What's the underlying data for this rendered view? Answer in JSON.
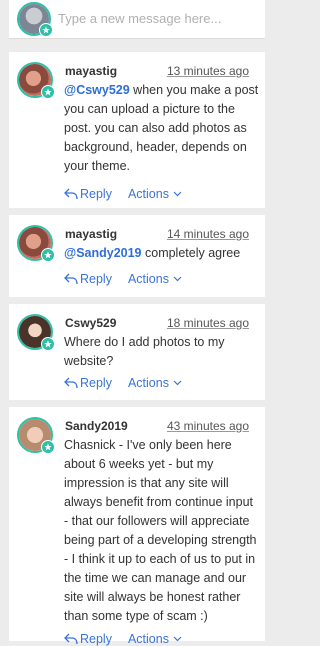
{
  "composer": {
    "placeholder": "Type a new message here..."
  },
  "comments": [
    {
      "author": "mayastig",
      "time": "13 minutes ago",
      "mention": "@Cswy529",
      "text": " when you make a post you can upload a picture to the post. you can also add photos as background, header, depends on your theme.",
      "reply_label": "Reply",
      "actions_label": "Actions"
    },
    {
      "author": "mayastig",
      "time": "14 minutes ago",
      "mention": "@Sandy2019",
      "text": " completely agree",
      "reply_label": "Reply",
      "actions_label": "Actions"
    },
    {
      "author": "Cswy529",
      "time": "18 minutes ago",
      "mention": "",
      "text": "Where do I add photos to my website?",
      "reply_label": "Reply",
      "actions_label": "Actions"
    },
    {
      "author": "Sandy2019",
      "time": "43 minutes ago",
      "mention": "",
      "text": "Chasnick - I've only been here about 6 weeks yet - but my impression is that any site will always benefit from continue input - that our followers will appreciate being part of a developing strength - I think it up to each of us to put in the time we can manage and our site will always be honest rather than some type of scam :)",
      "reply_label": "Reply",
      "actions_label": "Actions"
    }
  ],
  "colors": {
    "accent": "#2fbfa8",
    "link": "#3b73d8",
    "mention": "#2e6fd6"
  },
  "icons": {
    "reply": "reply-arrow-icon",
    "actions": "chevron-down-icon",
    "badge": "star-badge-icon"
  }
}
